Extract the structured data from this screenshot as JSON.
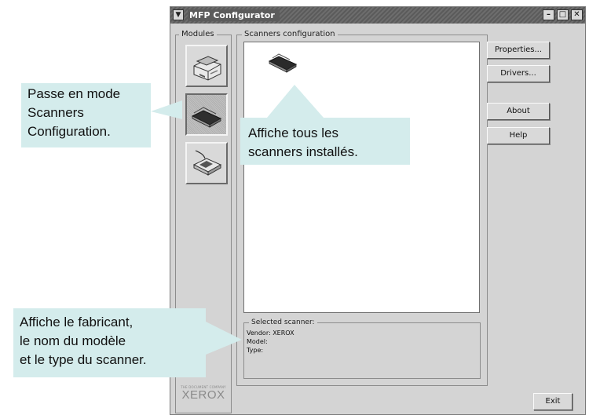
{
  "window": {
    "title": "MFP Configurator",
    "menu_icon": "chevron-down",
    "buttons": {
      "minimize": "–",
      "maximize": "□",
      "close": "✕"
    }
  },
  "modules": {
    "label": "Modules",
    "items": [
      {
        "name": "printers-module",
        "icon": "printer-icon"
      },
      {
        "name": "scanners-module",
        "icon": "scanner-icon",
        "active": true
      },
      {
        "name": "ports-module",
        "icon": "port-icon"
      }
    ]
  },
  "scanners": {
    "label": "Scanners configuration",
    "selected": {
      "label": "Selected scanner:",
      "vendor": "Vendor: XEROX",
      "model": "Model:",
      "type": "Type:"
    }
  },
  "actions": {
    "properties": "Properties...",
    "drivers": "Drivers...",
    "about": "About",
    "help": "Help",
    "exit": "Exit"
  },
  "brand": {
    "tagline": "THE DOCUMENT COMPANY",
    "name": "XEROX"
  },
  "callouts": {
    "left_top": [
      "Passe en mode",
      "Scanners",
      "Configuration."
    ],
    "center": [
      "Affiche tous les",
      "scanners installés."
    ],
    "left_bottom": [
      "Affiche le fabricant,",
      "le nom du modèle",
      "et le type du scanner."
    ]
  },
  "colors": {
    "callout": "#d4ecec",
    "window_bg": "#d4d4d4",
    "titlebar": "#5b5b5b"
  }
}
